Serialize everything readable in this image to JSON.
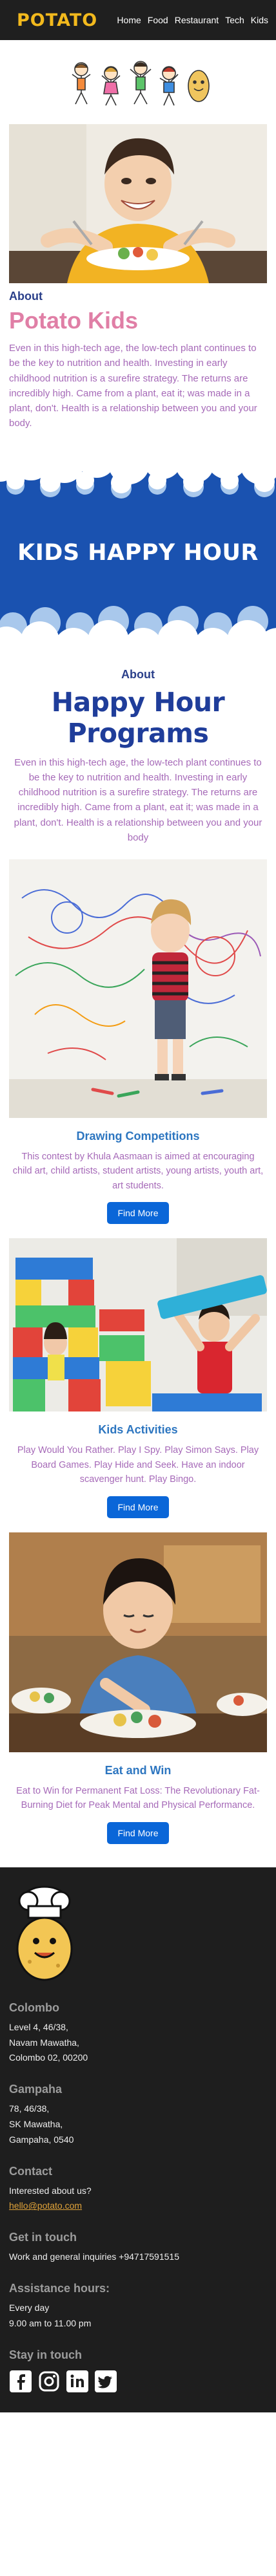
{
  "header": {
    "logo": "POTATO",
    "nav": [
      "Home",
      "Food",
      "Restaurant",
      "Tech",
      "Kids"
    ]
  },
  "about": {
    "label": "About",
    "title": "Potato Kids",
    "text": "Even in this high-tech age, the low-tech plant continues to be the key to nutrition and health. Investing in early childhood nutrition is a surefire strategy. The returns are incredibly high. Came from a plant, eat it; was made in a plant, don't. Health is a relationship between you and your body."
  },
  "banner": {
    "title": "KIDS HAPPY HOUR"
  },
  "happy": {
    "label": "About",
    "title": "Happy Hour Programs",
    "text": "Even in this high-tech age, the low-tech plant continues to be the key to nutrition and health. Investing in early childhood nutrition is a surefire strategy. The returns are incredibly high. Came from a plant, eat it; was made in a plant, don't. Health is a relationship between you and your body"
  },
  "cards": [
    {
      "title": "Drawing Competitions",
      "text": "This contest by Khula Aasmaan is aimed at encouraging child art, child artists, student artists, young artists, youth art, art students.",
      "button": "Find More"
    },
    {
      "title": "Kids Activities",
      "text": "Play Would You Rather. Play I Spy. Play Simon Says. Play Board Games. Play Hide and Seek. Have an indoor scavenger hunt. Play Bingo.",
      "button": "Find More"
    },
    {
      "title": "Eat and Win",
      "text": "Eat to Win for Permanent Fat Loss: The Revolutionary Fat-Burning Diet for Peak Mental and Physical Performance.",
      "button": "Find More"
    }
  ],
  "footer": {
    "colombo_head": "Colombo",
    "colombo_lines": [
      "Level 4, 46/38,",
      "Navam Mawatha,",
      "Colombo 02, 00200"
    ],
    "gampaha_head": "Gampaha",
    "gampaha_lines": [
      "78, 46/38,",
      "SK Mawatha,",
      "Gampaha, 0540"
    ],
    "contact_head": "Contact",
    "contact_text": "Interested about us?",
    "contact_email": "hello@potato.com",
    "touch_head": "Get in touch",
    "touch_text": "Work and general inquiries +94717591515",
    "hours_head": "Assistance hours:",
    "hours_lines": [
      "Every day",
      "9.00 am to 11.00 pm"
    ],
    "stay_head": "Stay in touch",
    "socials": [
      "facebook-icon",
      "instagram-icon",
      "linkedin-icon",
      "twitter-icon"
    ]
  }
}
